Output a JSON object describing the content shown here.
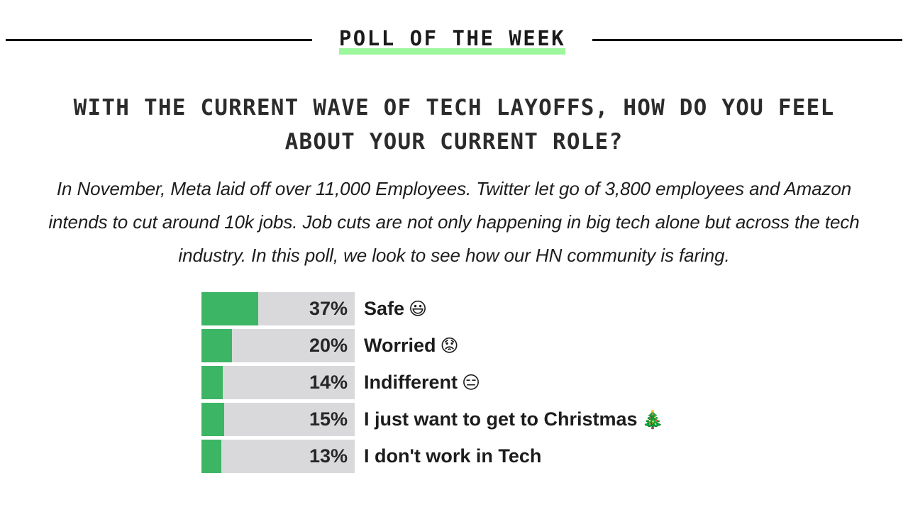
{
  "header": {
    "kicker": "POLL OF THE WEEK",
    "rule_color": "#111111",
    "underline_color": "#9df79d"
  },
  "question": "WITH THE CURRENT WAVE OF TECH LAYOFFS, HOW DO YOU FEEL ABOUT YOUR CURRENT ROLE?",
  "intro": "In November, Meta laid off over 11,000 Employees. Twitter let go of 3,800 employees and Amazon intends to cut around 10k jobs. Job cuts are not only happening in big tech alone but across the tech industry. In this poll, we look to see how our HN community is faring.",
  "colors": {
    "bar_fill": "#3cb665",
    "bar_track": "#d9d9db",
    "background": "#ffffff",
    "text": "#1c1c1c"
  },
  "chart_data": {
    "type": "bar",
    "title": "WITH THE CURRENT WAVE OF TECH LAYOFFS, HOW DO YOU FEEL ABOUT YOUR CURRENT ROLE?",
    "xlabel": "",
    "ylabel": "",
    "orientation": "horizontal",
    "unit": "percent",
    "xlim": [
      0,
      100
    ],
    "grid": false,
    "legend": "none",
    "categories": [
      "Safe",
      "Worried",
      "Indifferent",
      "I just want to get to Christmas",
      "I don't work in Tech"
    ],
    "values": [
      37,
      20,
      14,
      15,
      13
    ],
    "labels": [
      "37%",
      "20%",
      "14%",
      "15%",
      "13%"
    ],
    "emojis": [
      "😃",
      "😟",
      "😑",
      "🎄",
      ""
    ]
  },
  "results": [
    {
      "pct_label": "37%",
      "value": 37,
      "label": "Safe",
      "emoji": "😃",
      "emoji_name": "grinning-face-emoji"
    },
    {
      "pct_label": "20%",
      "value": 20,
      "label": "Worried",
      "emoji": "😟",
      "emoji_name": "worried-face-emoji"
    },
    {
      "pct_label": "14%",
      "value": 14,
      "label": "Indifferent",
      "emoji": "😑",
      "emoji_name": "expressionless-face-emoji"
    },
    {
      "pct_label": "15%",
      "value": 15,
      "label": "I just want to get to Christmas",
      "emoji": "🎄",
      "emoji_name": "christmas-tree-emoji"
    },
    {
      "pct_label": "13%",
      "value": 13,
      "label": "I don't work in Tech",
      "emoji": "",
      "emoji_name": ""
    }
  ]
}
